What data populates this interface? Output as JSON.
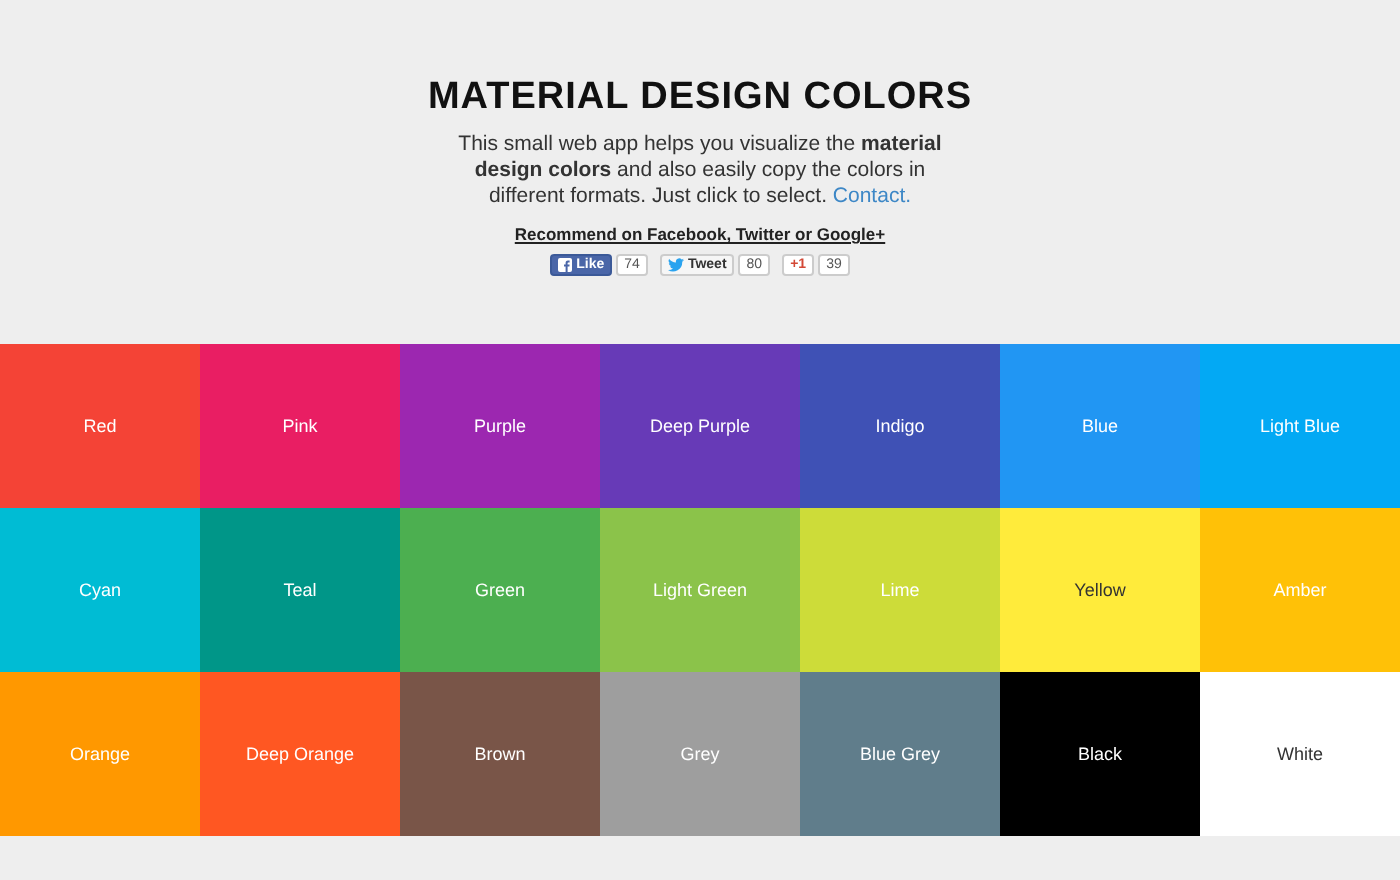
{
  "header": {
    "title": "MATERIAL DESIGN COLORS",
    "intro": "This small web app helps you visualize the **material design colors** and also easily copy the colors in different formats. Just click to select.",
    "contact_link": "Contact.",
    "recommend_link": "Recommend on Facebook, Twitter or Google+"
  },
  "social": [
    {
      "kind": "facebook",
      "label": "Like",
      "count": "74"
    },
    {
      "kind": "twitter",
      "label": "Tweet",
      "count": "80"
    },
    {
      "kind": "google",
      "label": "+1",
      "count": "39"
    }
  ],
  "colors": [
    {
      "name": "Red",
      "color": "#f44336"
    },
    {
      "name": "Pink",
      "color": "#e91e63"
    },
    {
      "name": "Purple",
      "color": "#9c27b0"
    },
    {
      "name": "Deep Purple",
      "color": "#673ab7"
    },
    {
      "name": "Indigo",
      "color": "#3f51b5"
    },
    {
      "name": "Blue",
      "color": "#2196f3"
    },
    {
      "name": "Light Blue",
      "color": "#03a9f4"
    },
    {
      "name": "Cyan",
      "color": "#00bcd4"
    },
    {
      "name": "Teal",
      "color": "#009688"
    },
    {
      "name": "Green",
      "color": "#4caf50"
    },
    {
      "name": "Light Green",
      "color": "#8bc34a"
    },
    {
      "name": "Lime",
      "color": "#cddc39"
    },
    {
      "name": "Yellow",
      "color": "#ffeb3b"
    },
    {
      "name": "Amber",
      "color": "#ffc107"
    },
    {
      "name": "Orange",
      "color": "#ff9800"
    },
    {
      "name": "Deep Orange",
      "color": "#ff5722"
    },
    {
      "name": "Brown",
      "color": "#795548"
    },
    {
      "name": "Grey",
      "color": "#9e9e9e"
    },
    {
      "name": "Blue Grey",
      "color": "#607d8b"
    },
    {
      "name": "Black",
      "color": "#000000"
    },
    {
      "name": "White",
      "color": "#ffffff"
    }
  ]
}
